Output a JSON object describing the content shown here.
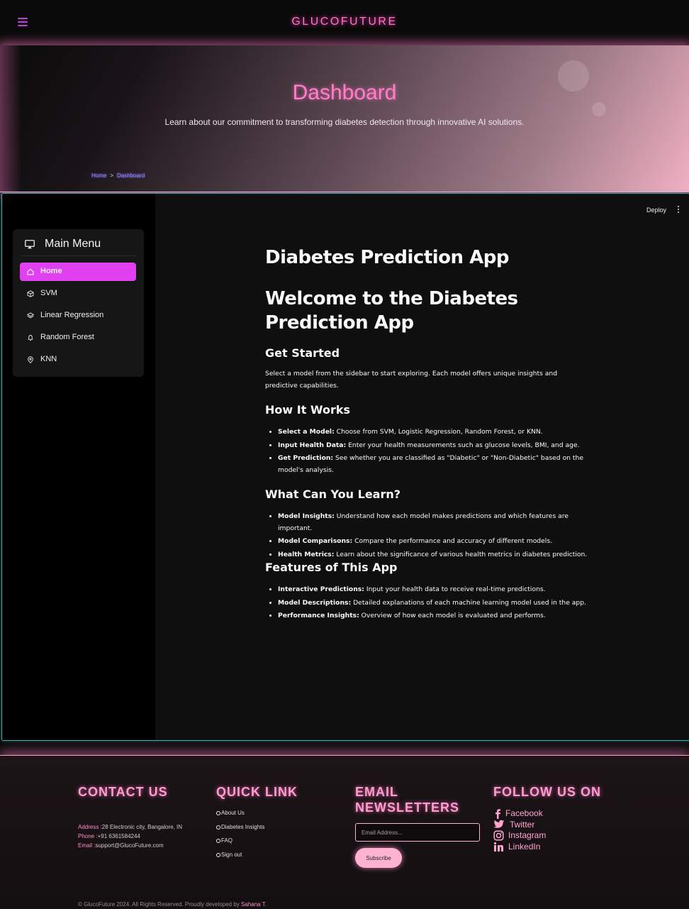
{
  "navbar": {
    "brand": "GLUCOFUTURE"
  },
  "hero": {
    "title": "Dashboard",
    "subtitle": "Learn about our commitment to transforming diabetes detection through innovative AI solutions.",
    "breadcrumb": {
      "home": "Home",
      "separator": ">",
      "current": "Dashboard"
    }
  },
  "app": {
    "toolbar": {
      "deploy_label": "Deploy"
    },
    "sidebar": {
      "title": "Main Menu",
      "items": [
        {
          "label": "Home",
          "icon": "house-icon",
          "active": true
        },
        {
          "label": "SVM",
          "icon": "cube-icon",
          "active": false
        },
        {
          "label": "Linear Regression",
          "icon": "layers-icon",
          "active": false
        },
        {
          "label": "Random Forest",
          "icon": "bell-icon",
          "active": false
        },
        {
          "label": "KNN",
          "icon": "map-pin-icon",
          "active": false
        }
      ]
    },
    "main": {
      "title": "Diabetes Prediction App",
      "welcome": "Welcome to the Diabetes Prediction App",
      "get_started": {
        "heading": "Get Started",
        "text": "Select a model from the sidebar to start exploring. Each model offers unique insights and predictive capabilities."
      },
      "how_it_works": {
        "heading": "How It Works",
        "items": [
          {
            "label": "Select a Model:",
            "text": " Choose from SVM, Logistic Regression, Random Forest, or KNN."
          },
          {
            "label": "Input Health Data:",
            "text": " Enter your health measurements such as glucose levels, BMI, and age."
          },
          {
            "label": "Get Prediction:",
            "text": " See whether you are classified as \"Diabetic\" or \"Non-Diabetic\" based on the model's analysis."
          }
        ]
      },
      "what_learn": {
        "heading": "What Can You Learn?",
        "items": [
          {
            "label": "Model Insights:",
            "text": " Understand how each model makes predictions and which features are important."
          },
          {
            "label": "Model Comparisons:",
            "text": " Compare the performance and accuracy of different models."
          },
          {
            "label": "Health Metrics:",
            "text": " Learn about the significance of various health metrics in diabetes prediction."
          }
        ]
      },
      "features": {
        "heading": "Features of This App",
        "items": [
          {
            "label": "Interactive Predictions:",
            "text": " Input your health data to receive real-time predictions."
          },
          {
            "label": "Model Descriptions:",
            "text": " Detailed explanations of each machine learning model used in the app."
          },
          {
            "label": "Performance Insights:",
            "text": " Overview of how each model is evaluated and performs."
          }
        ]
      }
    }
  },
  "footer": {
    "contact": {
      "heading": "CONTACT US",
      "address_label": "Address :",
      "address": "28 Electronic city, Bangalore, IN",
      "phone_label": "Phone :",
      "phone": "+91 6361584244",
      "email_label": "Email :",
      "email": "support@GlucoFuture.com"
    },
    "quick_link": {
      "heading": "QUICK LINK",
      "links": [
        "About Us",
        "Diabetes Insights",
        "FAQ",
        "Sign out"
      ]
    },
    "newsletter": {
      "heading_line1": "EMAIL",
      "heading_line2": "NEWSLETTERS",
      "placeholder": "Email Address...",
      "button": "Subscribe"
    },
    "follow": {
      "heading": "FOLLOW US ON",
      "links": [
        "Facebook",
        "Twitter",
        "Instagram",
        "LinkedIn"
      ]
    },
    "copyright": "© GlucoFuture 2024. All Rights Reserved. Proudly developed by ",
    "developer": "Sahana T",
    "copyright_end": "."
  },
  "colors": {
    "accent_pink": "#ff7fc8",
    "menu_active": "#e040ef",
    "frame_border": "#3fb5b1"
  }
}
